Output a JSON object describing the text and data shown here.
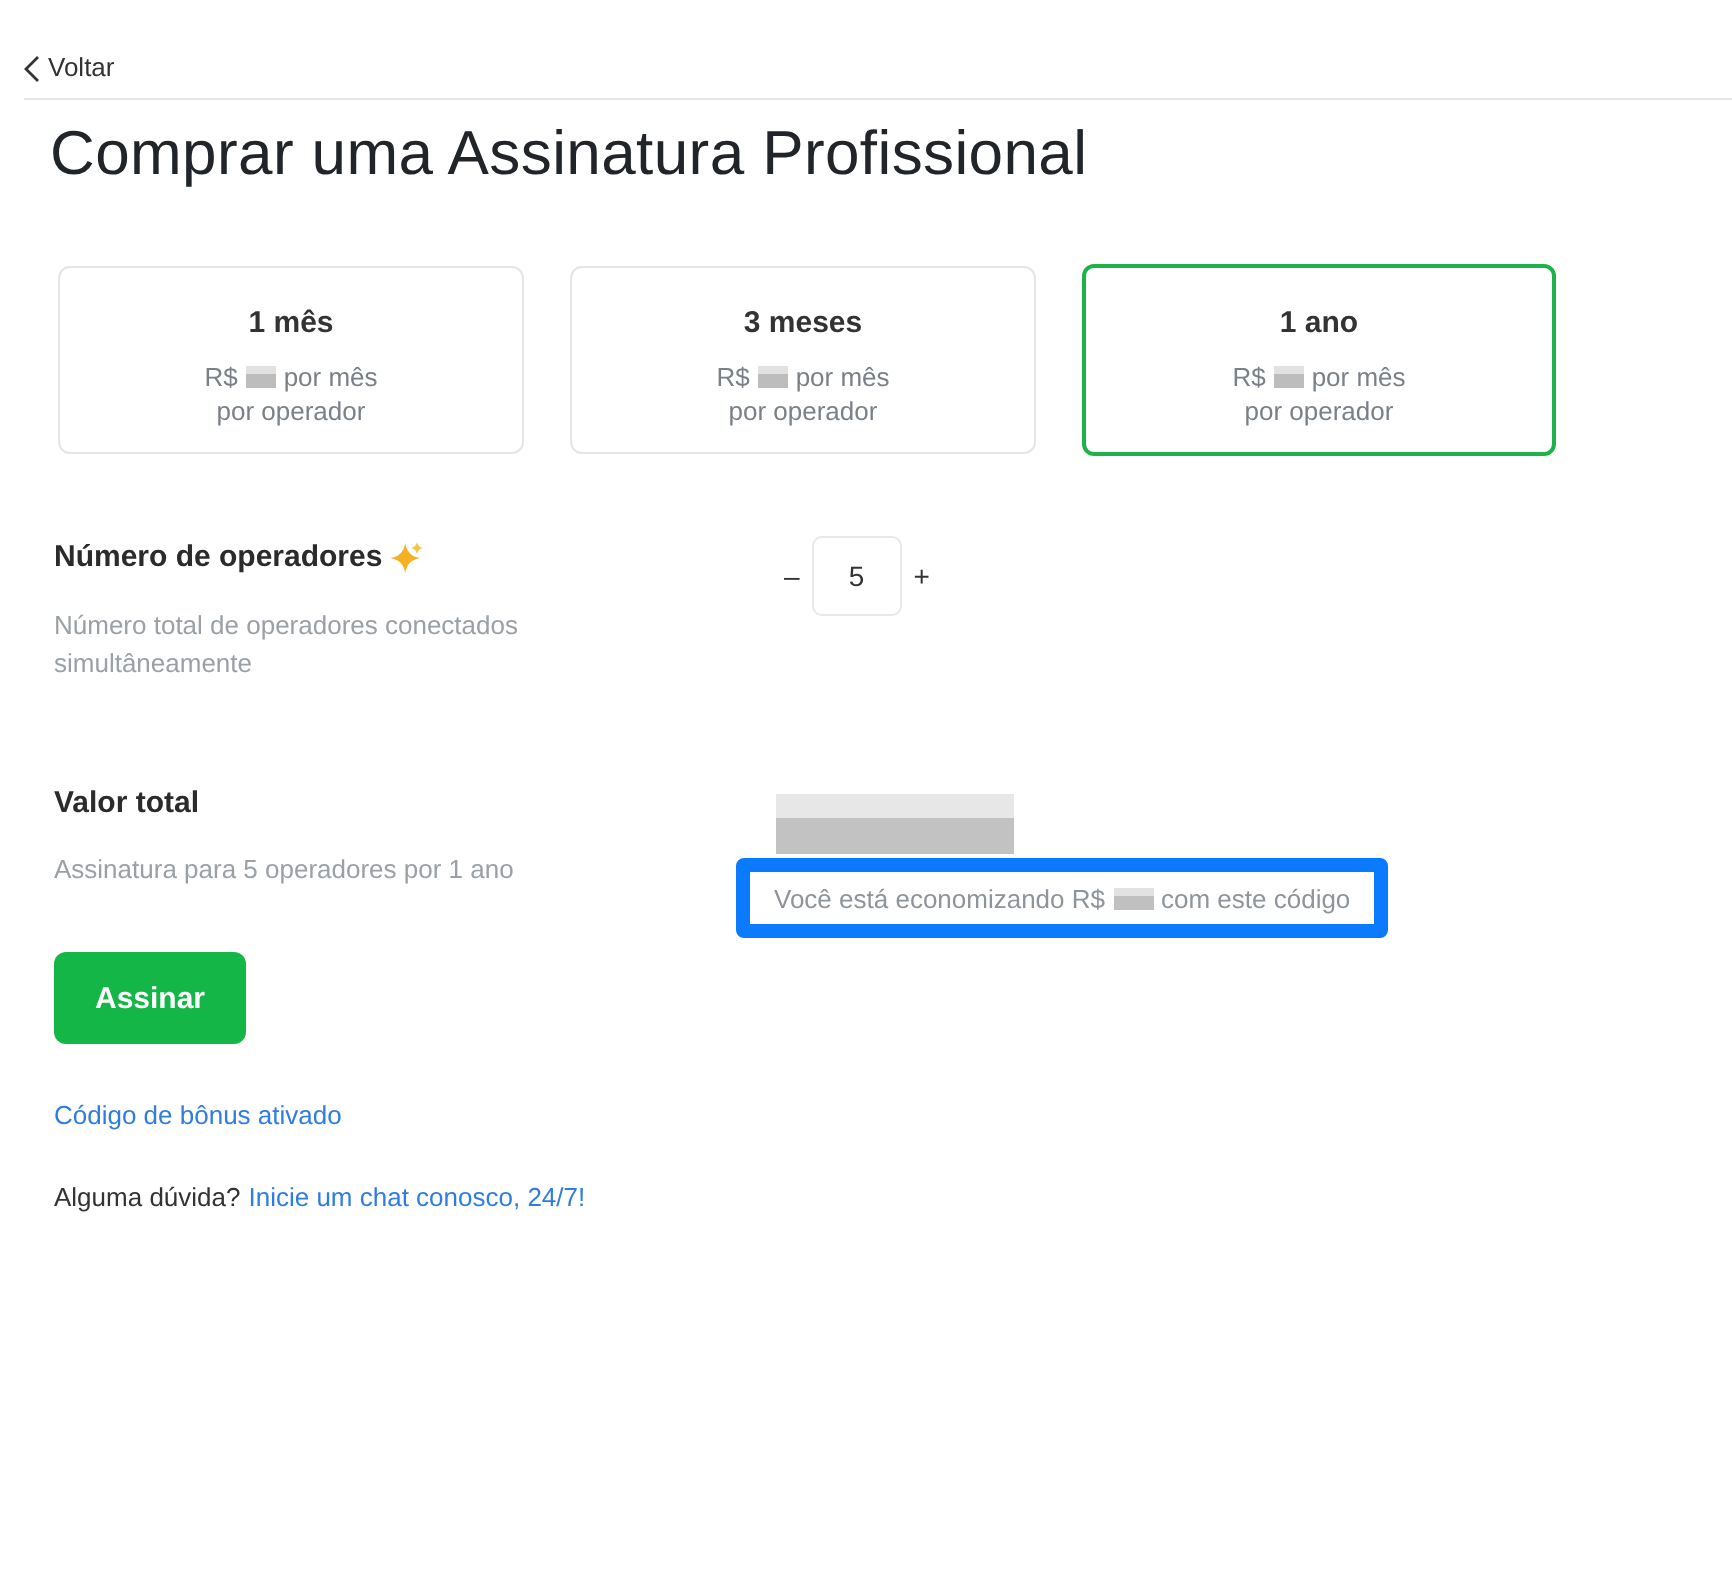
{
  "back_link": {
    "label": "Voltar"
  },
  "title": "Comprar uma Assinatura Profissional",
  "plans": [
    {
      "label": "1 mês",
      "currency": "R$",
      "period": "por mês",
      "per_operator": "por operador",
      "selected": false
    },
    {
      "label": "3 meses",
      "currency": "R$",
      "period": "por mês",
      "per_operator": "por operador",
      "selected": false
    },
    {
      "label": "1 ano",
      "currency": "R$",
      "period": "por mês",
      "per_operator": "por operador",
      "selected": true
    }
  ],
  "operators": {
    "label": "Número de operadores",
    "description": "Número total de operadores conectados simultâneamente",
    "decrement": "–",
    "value": "5",
    "increment": "+"
  },
  "total": {
    "label": "Valor total",
    "description": "Assinatura para 5 operadores por 1 ano",
    "savings": {
      "before": "Você está economizando R$",
      "after": "com este código",
      "highlighted": true
    }
  },
  "subscribe_button": "Assinar",
  "bonus_link": "Código de bônus ativado",
  "help": {
    "text": "Alguma dúvida?",
    "link": "Inicie um chat conosco, 24/7!"
  }
}
